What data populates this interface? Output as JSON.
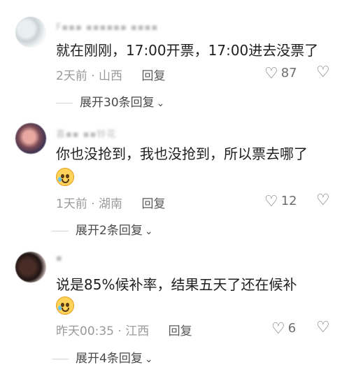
{
  "comments": [
    {
      "username": "F▪▪▪ ▪▪▪▪▪▪ ▪▪▪▪",
      "text": "就在刚刚，17:00开票，17:00进去没票了",
      "time": "2天前",
      "location": "山西",
      "reply_label": "回复",
      "likes": "87",
      "expand_label": "展开30条回复"
    },
    {
      "username": "喜▪▪ ▪▪铃花",
      "text": "你也没抢到，我也没抢到，所以票去哪了",
      "emoji": "cold-sweat-emoji",
      "time": "1天前",
      "location": "湖南",
      "reply_label": "回复",
      "likes": "12",
      "expand_label": "展开2条回复"
    },
    {
      "username": "▪",
      "text": "说是85%候补率，结果五天了还在候补",
      "emoji": "laughing-sweat-emoji",
      "time": "昨天00:35",
      "location": "江西",
      "reply_label": "回复",
      "likes": "6",
      "expand_label": "展开4条回复"
    }
  ],
  "icons": {
    "like": "heart-icon",
    "dislike": "broken-heart-icon",
    "expand": "chevron-down-icon"
  },
  "separator": "·"
}
